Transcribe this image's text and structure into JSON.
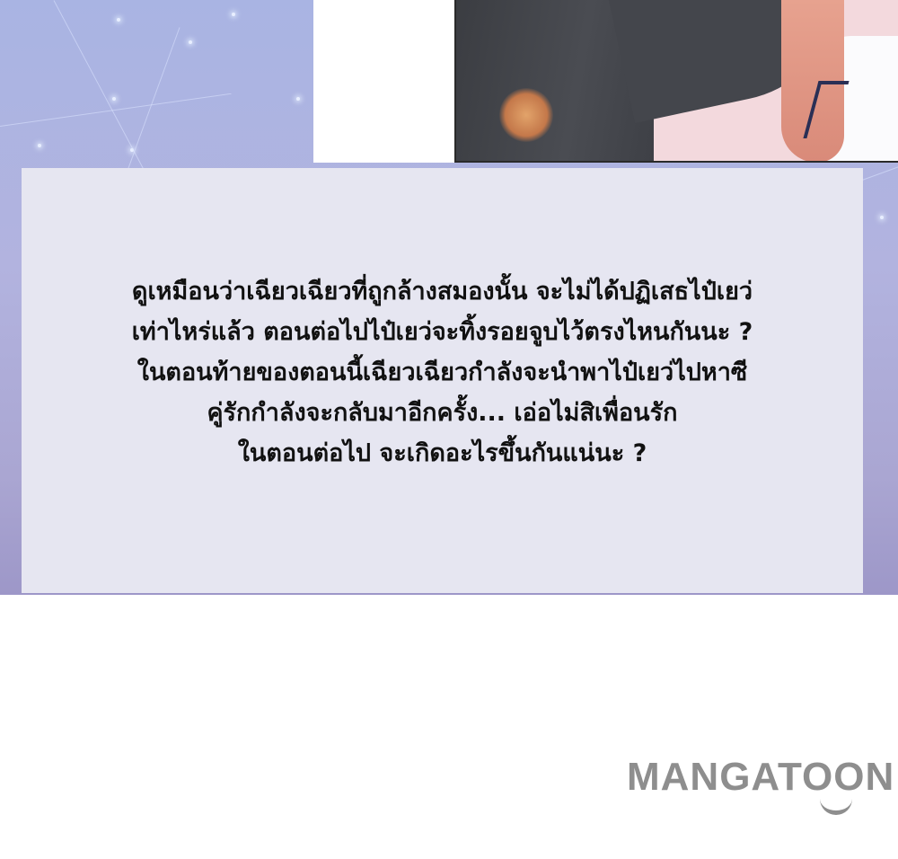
{
  "caption": {
    "lines": [
      "ดูเหมือนว่าเฉียวเฉียวที่ถูกล้างสมองนั้น จะไม่ได้ปฏิเสธไป๋เยว่",
      "เท่าไหร่แล้ว ตอนต่อไปไป๋เยว่จะทิ้งรอยจูบไว้ตรงไหนกันนะ ?",
      "ในตอนท้ายของตอนนี้เฉียวเฉียวกำลังจะนำพาไป๋เยว่ไปหาซี",
      "คู่รักกำลังจะกลับมาอีกครั้ง... เอ่อไม่สิเพื่อนรัก",
      "ในตอนต่อไป จะเกิดอะไรขึ้นกันแน่นะ ?"
    ]
  },
  "watermark": {
    "text": "MANGATOON",
    "color": "#8e8e8e"
  },
  "colors": {
    "caption_box": "#e6e6f1",
    "scene_background": "#b2b3df"
  }
}
